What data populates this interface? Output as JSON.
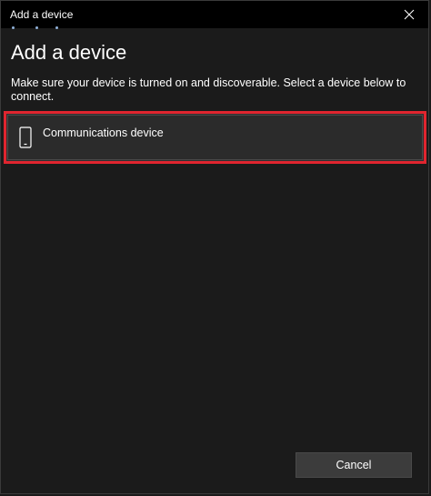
{
  "window": {
    "title": "Add a device"
  },
  "page": {
    "heading": "Add a device",
    "instructions": "Make sure your device is turned on and discoverable. Select a device below to connect."
  },
  "devices": [
    {
      "label": "Communications device",
      "icon": "phone-icon"
    }
  ],
  "footer": {
    "cancel_label": "Cancel"
  },
  "colors": {
    "selection_border": "#e0252f",
    "background": "#1b1b1b",
    "titlebar": "#000000",
    "button": "#3c3c3c"
  }
}
